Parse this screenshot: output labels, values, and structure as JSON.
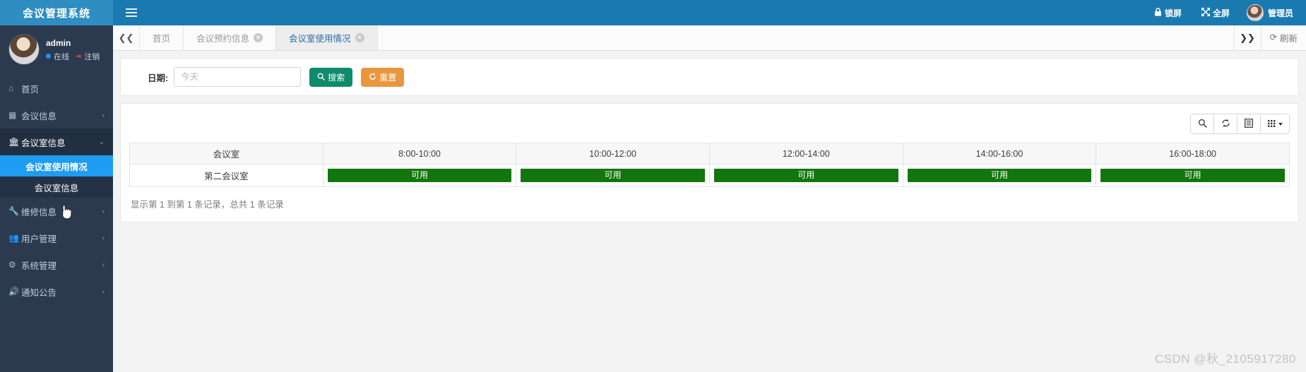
{
  "header": {
    "brand": "会议管理系统",
    "hamburger_icon": "hamburger-icon",
    "lock_label": "锁屏",
    "fullscreen_label": "全屏",
    "user_label": "管理员",
    "brand_color": "#2f8dc1",
    "bar_color": "#1a7ab0"
  },
  "sidebar": {
    "user": {
      "name": "admin",
      "status": "在线",
      "logout": "注销"
    },
    "items": [
      {
        "label": "首页",
        "icon": "home-icon",
        "arrow": "",
        "expanded": false
      },
      {
        "label": "会议信息",
        "icon": "calendar-icon",
        "arrow": "‹",
        "expanded": false
      },
      {
        "label": "会议室信息",
        "icon": "bank-icon",
        "arrow": "⌄",
        "expanded": true
      },
      {
        "label": "维修信息",
        "icon": "wrench-icon",
        "arrow": "‹",
        "expanded": false
      },
      {
        "label": "用户管理",
        "icon": "users-icon",
        "arrow": "‹",
        "expanded": false
      },
      {
        "label": "系统管理",
        "icon": "gear-icon",
        "arrow": "‹",
        "expanded": false
      },
      {
        "label": "通知公告",
        "icon": "megaphone-icon",
        "arrow": "‹",
        "expanded": false
      }
    ],
    "submenu": [
      {
        "label": "会议室使用情况",
        "active": true
      },
      {
        "label": "会议室信息",
        "active": false
      }
    ],
    "active_color": "#1e9cf2",
    "bg_color": "#2b3a4f"
  },
  "tabbar": {
    "prev_icon": "double-chevron-left-icon",
    "next_icon": "double-chevron-right-icon",
    "refresh_label": "刷新",
    "refresh_icon": "refresh-icon",
    "tabs": [
      {
        "label": "首页",
        "closable": false,
        "active": false
      },
      {
        "label": "会议预约信息",
        "closable": true,
        "active": false
      },
      {
        "label": "会议室使用情况",
        "closable": true,
        "active": true
      }
    ]
  },
  "search": {
    "date_label": "日期:",
    "date_value": "",
    "date_placeholder": "今天",
    "search_label": "搜索",
    "search_icon": "search-icon",
    "reset_label": "重置",
    "reset_icon": "refresh-icon",
    "search_color": "#0e8a6d",
    "reset_color": "#e8973f"
  },
  "table_toolbar": {
    "buttons": [
      {
        "icon": "search-icon",
        "name": "toolbar-search-button"
      },
      {
        "icon": "refresh-icon",
        "name": "toolbar-refresh-button"
      },
      {
        "icon": "list-icon",
        "name": "toolbar-toggle-view-button"
      },
      {
        "icon": "grid-icon",
        "name": "toolbar-columns-button"
      }
    ]
  },
  "table": {
    "columns": [
      "会议室",
      "8:00-10:00",
      "10:00-12:00",
      "12:00-14:00",
      "14:00-16:00",
      "16:00-18:00"
    ],
    "rows": [
      {
        "room": "第二会议室",
        "slots": [
          "可用",
          "可用",
          "可用",
          "可用",
          "可用"
        ]
      }
    ],
    "available_color": "#11760d",
    "footer": "显示第 1 到第 1 条记录，总共 1 条记录"
  },
  "watermark": "CSDN @秋_2105917280"
}
